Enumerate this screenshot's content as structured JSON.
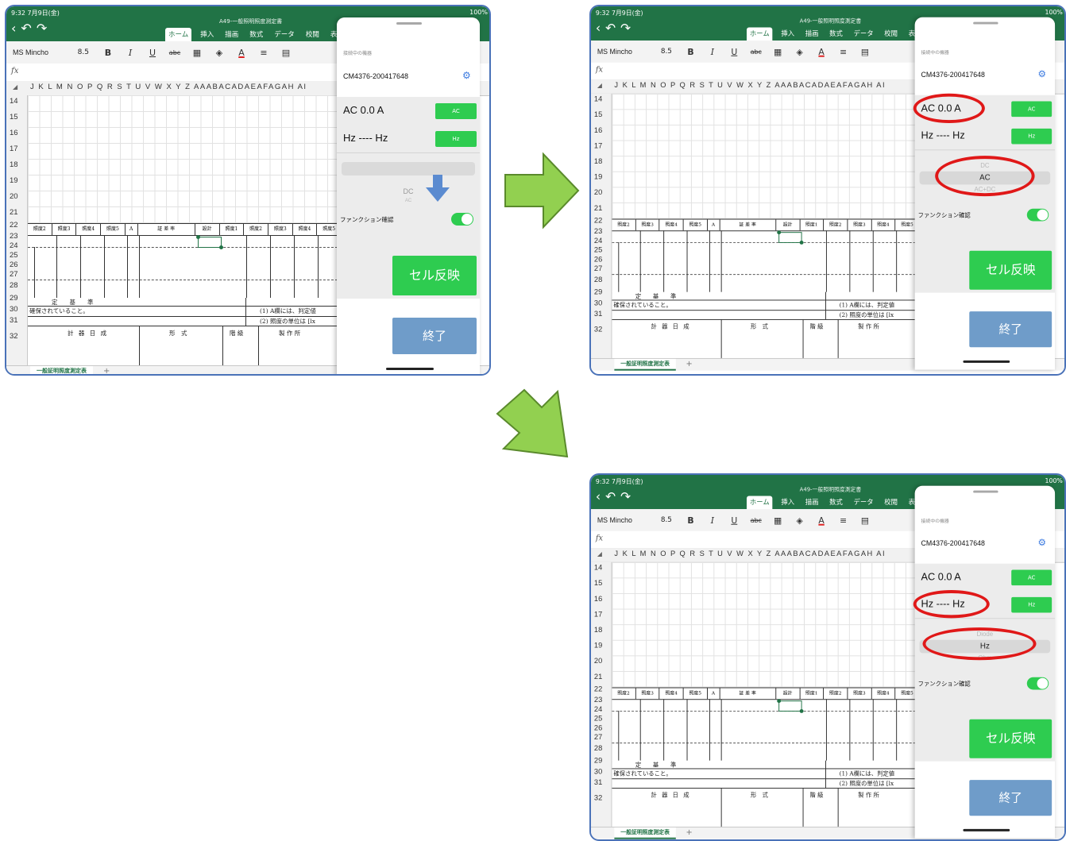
{
  "excel": {
    "status_time": "9:32  7月9日(金)",
    "status_battery": "100%",
    "doc_title": "A49-一般照明照度測定書",
    "nav_back": "‹",
    "nav_undo": "↶",
    "nav_redo": "↷",
    "ribbon_tabs": [
      "ホーム",
      "挿入",
      "描画",
      "数式",
      "データ",
      "校閲",
      "表示"
    ],
    "font_name": "MS Mincho",
    "font_size": "8.5",
    "toolbar_bold": "B",
    "toolbar_italic": "I",
    "toolbar_underline": "U",
    "toolbar_strike": "abc",
    "fx_label": "fx",
    "column_headers": "J K L M N O P Q R S T U V W X Y Z AAABACADAEAFAGAH AI",
    "row_numbers": [
      "14",
      "15",
      "16",
      "17",
      "18",
      "19",
      "20",
      "21",
      "22",
      "23",
      "24",
      "25",
      "26",
      "27",
      "28",
      "29",
      "30",
      "31",
      "32"
    ],
    "table_header_cells": [
      "照度2",
      "照度3",
      "照度4",
      "照度5",
      "A",
      "証 差 率",
      "設計",
      "照度1",
      "照度2",
      "照度3",
      "照度4",
      "照度5"
    ],
    "row28_text": "定　　基　　準",
    "row29_left": "確保されていること。",
    "row29_right": "(1) A欄には、判定値",
    "row30_right": "(2) 照度の単位は [lx",
    "row31_cells": [
      "計 器 日 成",
      "形　式",
      "階 級",
      "製 作 所"
    ],
    "sheet_tab": "一般証明照度測定表",
    "add_sheet": "+"
  },
  "panel": {
    "connected_label": "接続中の機器",
    "device_id": "CM4376-200417648",
    "reading_ac": "AC 0.0 A",
    "reading_hz": "Hz ---- Hz",
    "ac_button": "AC",
    "hz_button": "Hz",
    "function_check_label": "ファンクション確認",
    "function_check_on": true,
    "cell_reflect_button": "セル反映",
    "end_button": "終了"
  },
  "pickers": {
    "shot1": {
      "prev": "",
      "selected": "",
      "next": "DC",
      "next2": "AC"
    },
    "shot2": {
      "prev": "DC",
      "selected": "AC",
      "next": "AC+DC",
      "next2": ""
    },
    "shot3": {
      "prev": "Diode",
      "selected": "Hz",
      "next": "Ohm",
      "next2": ""
    }
  },
  "colors": {
    "excel_green": "#217346",
    "button_green": "#2ecc50",
    "end_button_blue": "#6f9cc9",
    "highlight_red": "#e01818",
    "arrow_green": "#92d050",
    "hint_arrow_blue": "#5b8bd0"
  }
}
